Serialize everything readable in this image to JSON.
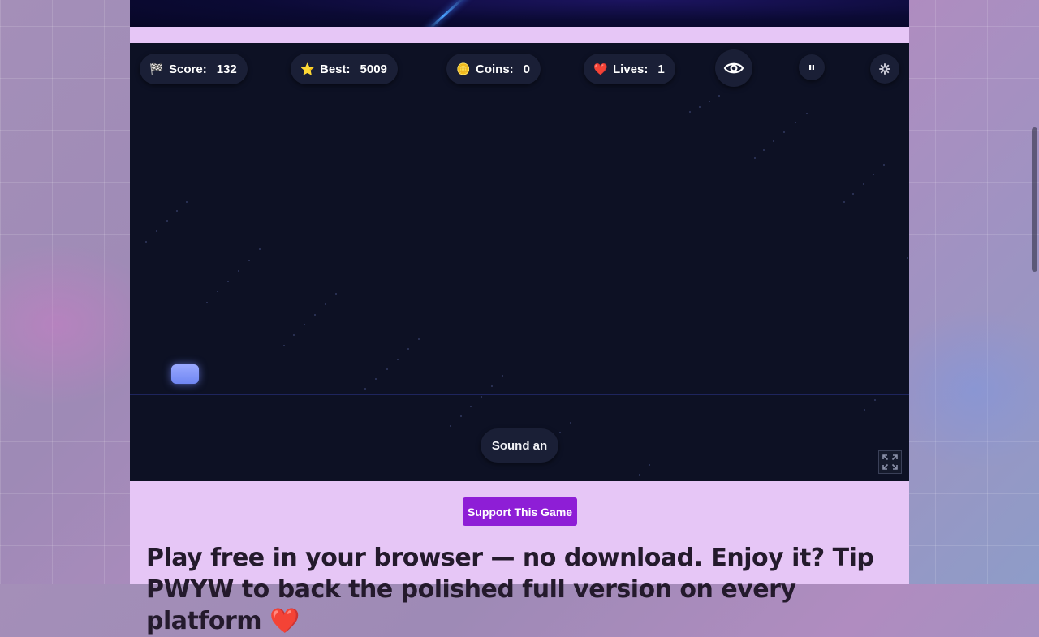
{
  "hud": {
    "score": {
      "icon": "checkered-flag-icon",
      "glyph": "🏁",
      "label": "Score:",
      "value": "132"
    },
    "best": {
      "icon": "star-icon",
      "glyph": "⭐",
      "label": "Best:",
      "value": "5009"
    },
    "coins": {
      "icon": "coin-icon",
      "glyph": "🪙",
      "label": "Coins:",
      "value": "0"
    },
    "lives": {
      "icon": "heart-icon",
      "glyph": "❤️",
      "label": "Lives:",
      "value": "1"
    },
    "buttons": {
      "view": "eye-icon",
      "pause": "pause-icon",
      "settings": "gear-icon"
    }
  },
  "game": {
    "sound_button": "Sound an",
    "fullscreen_icon": "fullscreen-icon",
    "player_color": "#7b8ef5",
    "background_color": "#0d1124"
  },
  "support_button": "Support This Game",
  "headline": "Play free in your browser — no download. Enjoy it? Tip PWYW to back the polished full version on every platform ❤️",
  "colors": {
    "page_column": "#e6c6f6",
    "support_button": "#8e1ed6"
  }
}
